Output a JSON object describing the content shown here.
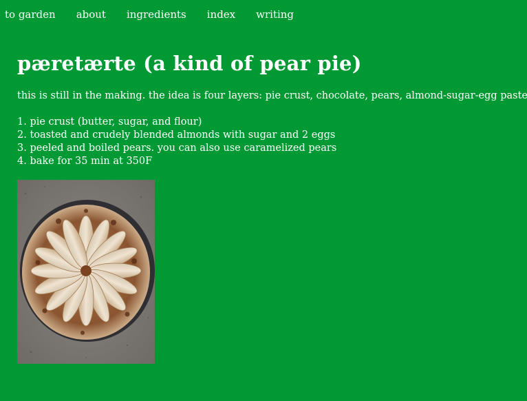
{
  "nav": {
    "items": [
      {
        "label": "to garden"
      },
      {
        "label": "about"
      },
      {
        "label": "ingredients"
      },
      {
        "label": "index"
      },
      {
        "label": "writing"
      }
    ]
  },
  "page": {
    "title": "pæretærte (a kind of pear pie)",
    "intro": "this is still in the making. the idea is four layers: pie crust, chocolate, pears, almond-sugar-egg paste.",
    "steps": [
      "1. pie crust (butter, sugar, and flour)",
      "2. toasted and crudely blended almonds with sugar and 2 eggs",
      "3. peeled and boiled pears. you can also use caramelized pears",
      "4. bake for 35 min at 350F"
    ]
  },
  "colors": {
    "background": "#009933",
    "text": "#ffffff"
  }
}
